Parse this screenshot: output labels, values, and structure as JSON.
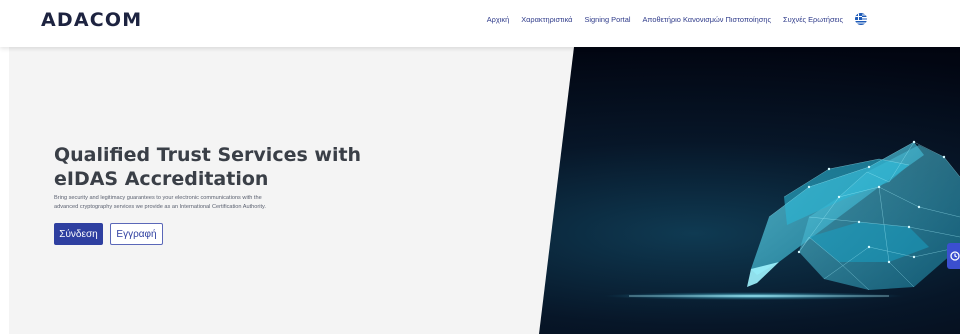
{
  "header": {
    "logo": "ADACOM",
    "nav": [
      {
        "label": "Αρχική"
      },
      {
        "label": "Χαρακτηριστικά"
      },
      {
        "label": "Signing Portal"
      },
      {
        "label": "Αποθετήριο Κανονισμών Πιστοποίησης"
      },
      {
        "label": "Συχνές Ερωτήσεις"
      }
    ],
    "language_icon": "greek-flag-icon"
  },
  "hero": {
    "title_line1": "Qualified Trust Services with",
    "title_line2": "eIDAS Accreditation",
    "subtitle_line1": "Bring security and legitimacy guarantees to your electronic communications with the",
    "subtitle_line2": "advanced cryptography services we provide as an International Certification Authority.",
    "login_label": "Σύνδεση",
    "register_label": "Εγγραφή",
    "image_icon": "low-poly-hand-writing-icon"
  },
  "side_widget": {
    "icon": "clock-icon"
  },
  "colors": {
    "brand": "#1d2340",
    "nav_link": "#2f3b8a",
    "primary_button": "#2e3fa0",
    "hero_background": "#f4f4f4",
    "art_glow": "#3fd6f0"
  }
}
